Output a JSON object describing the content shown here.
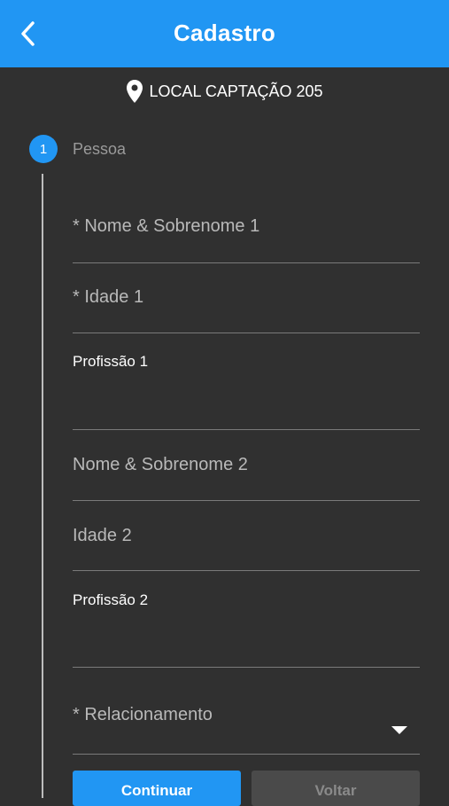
{
  "header": {
    "title": "Cadastro",
    "back_icon": "chevron-left-icon"
  },
  "location": {
    "icon": "map-pin-icon",
    "label": "LOCAL CAPTAÇÃO 205"
  },
  "stepper": {
    "step_number": "1",
    "step_label": "Pessoa"
  },
  "form": {
    "name1_label": "* Nome & Sobrenome 1",
    "age1_label": "* Idade 1",
    "profession1_label": "Profissão 1",
    "profession1_value": "",
    "name2_label": "Nome & Sobrenome 2",
    "age2_label": "Idade 2",
    "profession2_label": "Profissão 2",
    "profession2_value": "",
    "relationship_label": "* Relacionamento"
  },
  "actions": {
    "continue_label": "Continuar",
    "back_label": "Voltar"
  },
  "colors": {
    "accent": "#2196F3",
    "background": "#303030"
  }
}
